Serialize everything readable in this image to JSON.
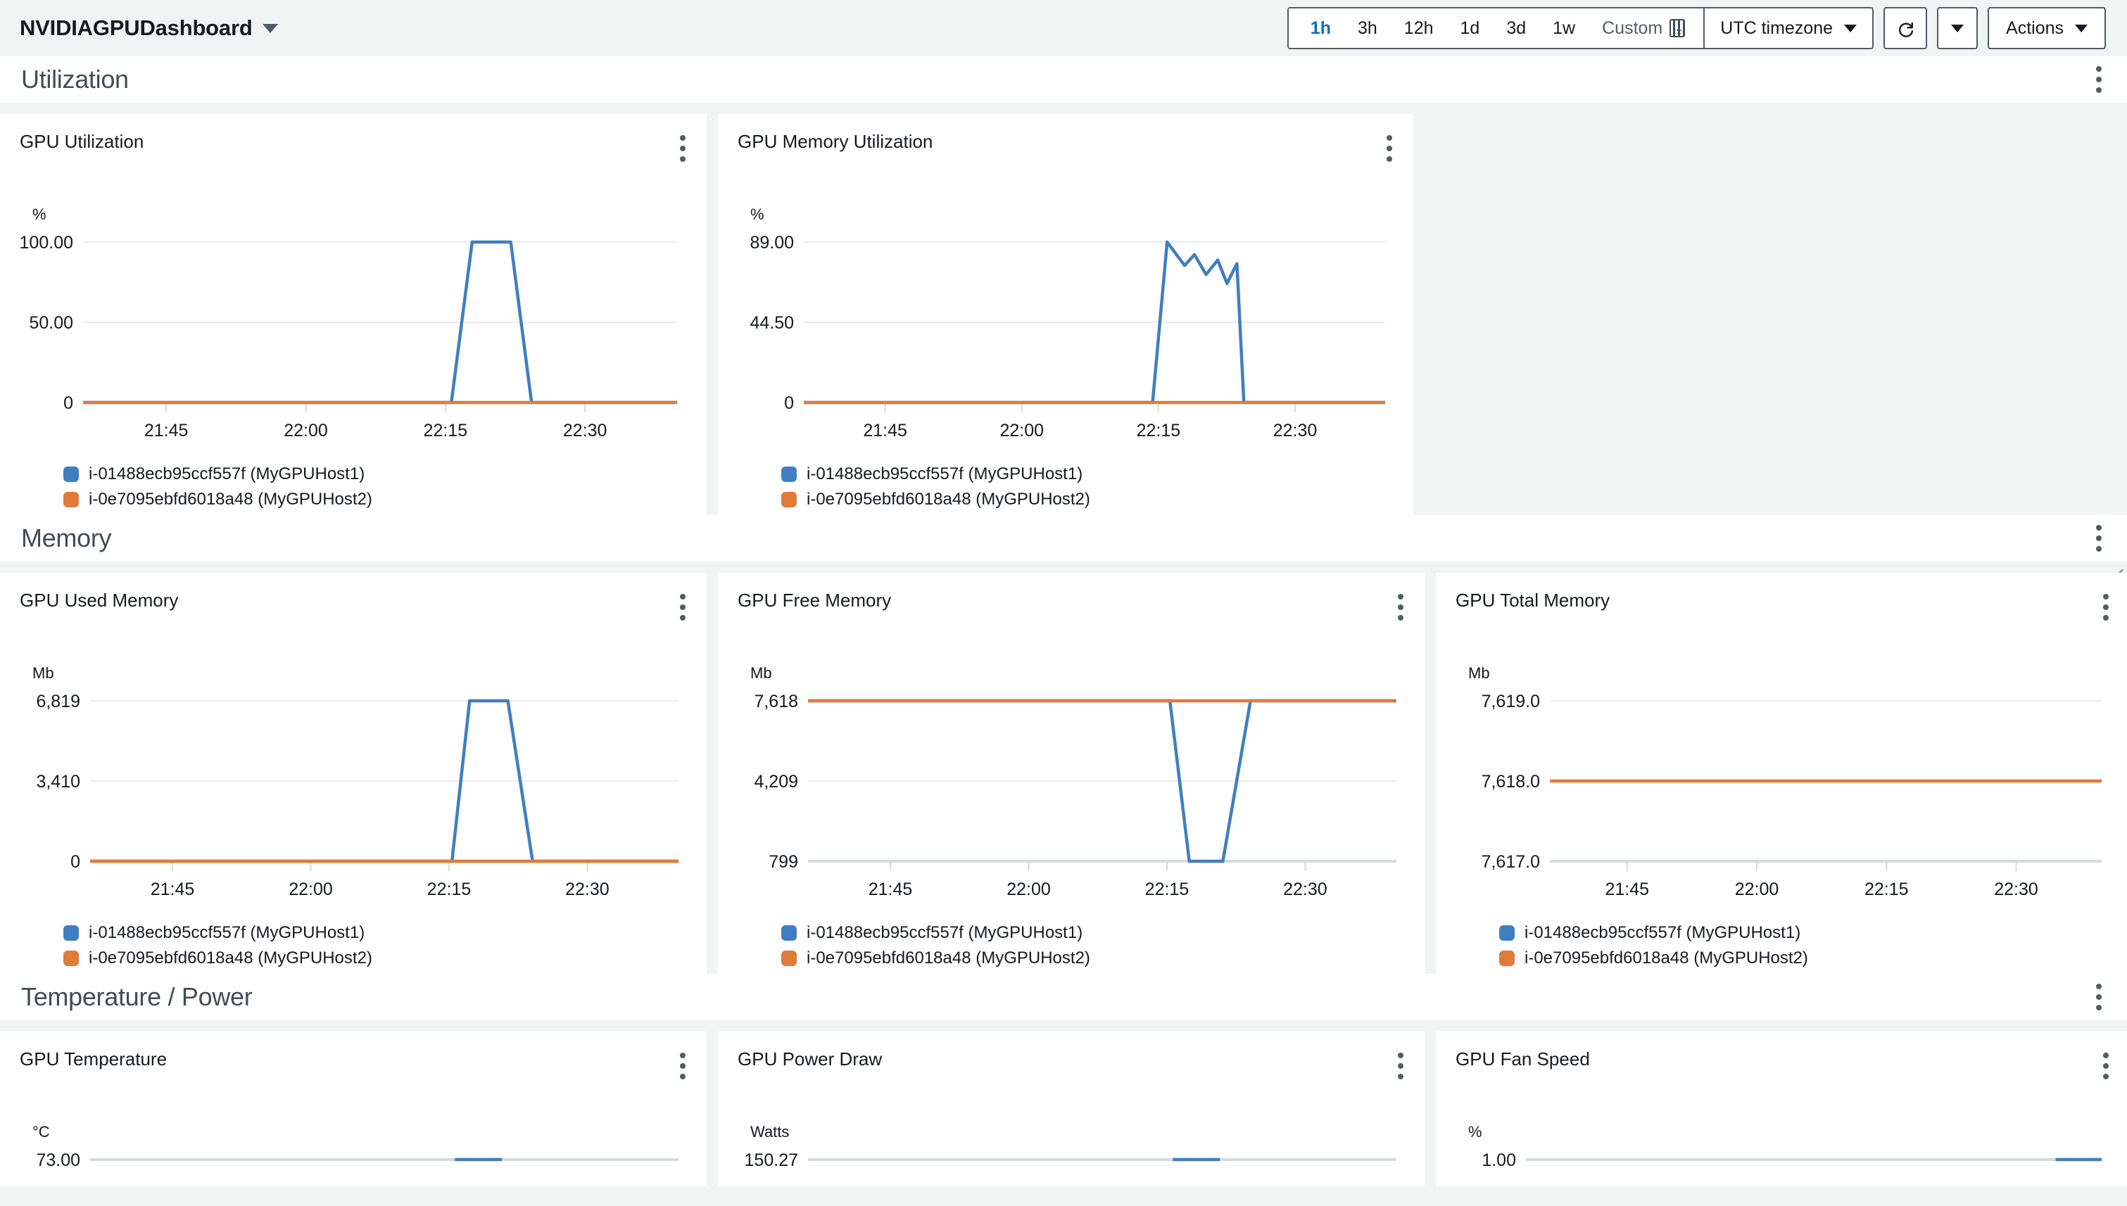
{
  "header": {
    "dashboard_title": "NVIDIAGPUDashboard",
    "title_caret_icon": "chevron-down-icon",
    "time_ranges": [
      {
        "label": "1h",
        "active": true
      },
      {
        "label": "3h",
        "active": false
      },
      {
        "label": "12h",
        "active": false
      },
      {
        "label": "1d",
        "active": false
      },
      {
        "label": "3d",
        "active": false
      },
      {
        "label": "1w",
        "active": false
      }
    ],
    "custom_label": "Custom",
    "calendar_icon": "calendar-icon",
    "timezone_label": "UTC timezone",
    "refresh_icon": "refresh-icon",
    "refresh_options_icon": "chevron-down-icon",
    "actions_label": "Actions"
  },
  "colors": {
    "series_blue": "#3f7fbf",
    "series_orange": "#e07b39",
    "accent_blue": "#0073bb",
    "page_bg": "#f2f3f3",
    "widget_bg": "#ffffff",
    "text": "#16191f",
    "section_title": "#444c55",
    "gridline": "#eaeded",
    "axis_line": "#d5dbdb"
  },
  "legend": {
    "series": [
      {
        "label": "i-01488ecb95ccf557f (MyGPUHost1)",
        "color": "#3f7fbf"
      },
      {
        "label": "i-0e7095ebfd6018a48 (MyGPUHost2)",
        "color": "#e07b39"
      }
    ]
  },
  "sections": [
    {
      "name": "Utilization",
      "kebab_icon": "kebab-menu-icon"
    },
    {
      "name": "Memory",
      "kebab_icon": "kebab-menu-icon"
    },
    {
      "name": "Temperature / Power",
      "kebab_icon": "kebab-menu-icon"
    }
  ],
  "chart_data": [
    {
      "type": "line",
      "title": "GPU Utilization",
      "ylabel": "%",
      "xlabel": "",
      "ylim": [
        0,
        100
      ],
      "yticks": [
        "0",
        "50.00",
        "100.00"
      ],
      "ytick_values": [
        0,
        50,
        100
      ],
      "xticks": [
        "21:45",
        "22:00",
        "22:15",
        "22:30"
      ],
      "grid": true,
      "legend_position": "bottom",
      "series": [
        {
          "name": "i-01488ecb95ccf557f (MyGPUHost1)",
          "color": "#3f7fbf",
          "x": [
            0,
            0.62,
            0.655,
            0.72,
            0.755,
            1.0
          ],
          "values": [
            0,
            0,
            100,
            100,
            0,
            0
          ]
        },
        {
          "name": "i-0e7095ebfd6018a48 (MyGPUHost2)",
          "color": "#e07b39",
          "x": [
            0,
            1.0
          ],
          "values": [
            0,
            0
          ]
        }
      ]
    },
    {
      "type": "line",
      "title": "GPU Memory Utilization",
      "ylabel": "%",
      "xlabel": "",
      "ylim": [
        0,
        89
      ],
      "yticks": [
        "0",
        "44.50",
        "89.00"
      ],
      "ytick_values": [
        0,
        44.5,
        89
      ],
      "xticks": [
        "21:45",
        "22:00",
        "22:15",
        "22:30"
      ],
      "grid": true,
      "legend_position": "bottom",
      "series": [
        {
          "name": "i-01488ecb95ccf557f (MyGPUHost1)",
          "color": "#3f7fbf",
          "x": [
            0,
            0.6,
            0.625,
            0.655,
            0.672,
            0.692,
            0.712,
            0.728,
            0.745,
            0.757,
            1.0
          ],
          "values": [
            0,
            0,
            89,
            76,
            82,
            71,
            79,
            66,
            77,
            0,
            0
          ]
        },
        {
          "name": "i-0e7095ebfd6018a48 (MyGPUHost2)",
          "color": "#e07b39",
          "x": [
            0,
            1.0
          ],
          "values": [
            0,
            0
          ]
        }
      ]
    },
    {
      "type": "line",
      "title": "GPU Used Memory",
      "ylabel": "Mb",
      "xlabel": "",
      "ylim": [
        0,
        6819
      ],
      "yticks": [
        "0",
        "3,410",
        "6,819"
      ],
      "ytick_values": [
        0,
        3410,
        6819
      ],
      "xticks": [
        "21:45",
        "22:00",
        "22:15",
        "22:30"
      ],
      "grid": true,
      "legend_position": "bottom",
      "series": [
        {
          "name": "i-01488ecb95ccf557f (MyGPUHost1)",
          "color": "#3f7fbf",
          "x": [
            0,
            0.615,
            0.645,
            0.71,
            0.752,
            1.0
          ],
          "values": [
            0,
            0,
            6819,
            6819,
            0,
            0
          ]
        },
        {
          "name": "i-0e7095ebfd6018a48 (MyGPUHost2)",
          "color": "#e07b39",
          "x": [
            0,
            1.0
          ],
          "values": [
            0,
            0
          ]
        }
      ]
    },
    {
      "type": "line",
      "title": "GPU Free Memory",
      "ylabel": "Mb",
      "xlabel": "",
      "ylim": [
        799,
        7618
      ],
      "yticks": [
        "799",
        "4,209",
        "7,618"
      ],
      "ytick_values": [
        799,
        4209,
        7618
      ],
      "xticks": [
        "21:45",
        "22:00",
        "22:15",
        "22:30"
      ],
      "grid": true,
      "legend_position": "bottom",
      "series": [
        {
          "name": "i-01488ecb95ccf557f (MyGPUHost1)",
          "color": "#3f7fbf",
          "x": [
            0,
            0.615,
            0.648,
            0.705,
            0.752,
            1.0
          ],
          "values": [
            7618,
            7618,
            799,
            799,
            7618,
            7618
          ]
        },
        {
          "name": "i-0e7095ebfd6018a48 (MyGPUHost2)",
          "color": "#e07b39",
          "x": [
            0,
            1.0
          ],
          "values": [
            7618,
            7618
          ]
        }
      ]
    },
    {
      "type": "line",
      "title": "GPU Total Memory",
      "ylabel": "Mb",
      "xlabel": "",
      "ylim": [
        7617,
        7619
      ],
      "yticks": [
        "7,617.0",
        "7,618.0",
        "7,619.0"
      ],
      "ytick_values": [
        7617,
        7618,
        7619
      ],
      "xticks": [
        "21:45",
        "22:00",
        "22:15",
        "22:30"
      ],
      "grid": true,
      "legend_position": "bottom",
      "series": [
        {
          "name": "i-01488ecb95ccf557f (MyGPUHost1)",
          "color": "#3f7fbf",
          "x": [],
          "values": []
        },
        {
          "name": "i-0e7095ebfd6018a48 (MyGPUHost2)",
          "color": "#e07b39",
          "x": [
            0,
            1.0
          ],
          "values": [
            7618,
            7618
          ]
        }
      ]
    },
    {
      "type": "line",
      "title": "GPU Temperature",
      "ylabel": "°C",
      "xlabel": "",
      "ylim": [
        0,
        73
      ],
      "yticks": [
        "73.00"
      ],
      "ytick_values": [
        73
      ],
      "xticks": [],
      "grid": true,
      "legend_position": "bottom",
      "series": [
        {
          "name": "i-01488ecb95ccf557f (MyGPUHost1)",
          "color": "#3f7fbf",
          "x": [
            0.62,
            0.66,
            0.7
          ],
          "values": [
            73,
            73,
            73
          ]
        }
      ]
    },
    {
      "type": "line",
      "title": "GPU Power Draw",
      "ylabel": "Watts",
      "xlabel": "",
      "ylim": [
        0,
        150.27
      ],
      "yticks": [
        "150.27"
      ],
      "ytick_values": [
        150.27
      ],
      "xticks": [],
      "grid": true,
      "legend_position": "bottom",
      "series": [
        {
          "name": "i-01488ecb95ccf557f (MyGPUHost1)",
          "color": "#3f7fbf",
          "x": [
            0.62,
            0.66,
            0.7
          ],
          "values": [
            150.27,
            150.27,
            150.27
          ]
        }
      ]
    },
    {
      "type": "line",
      "title": "GPU Fan Speed",
      "ylabel": "%",
      "xlabel": "",
      "ylim": [
        0,
        1
      ],
      "yticks": [
        "1.00"
      ],
      "ytick_values": [
        1
      ],
      "xticks": [],
      "grid": true,
      "legend_position": "bottom",
      "series": [
        {
          "name": "i-01488ecb95ccf557f (MyGPUHost1)",
          "color": "#3f7fbf",
          "x": [
            0.92,
            1.0
          ],
          "values": [
            1,
            1
          ]
        }
      ]
    }
  ]
}
